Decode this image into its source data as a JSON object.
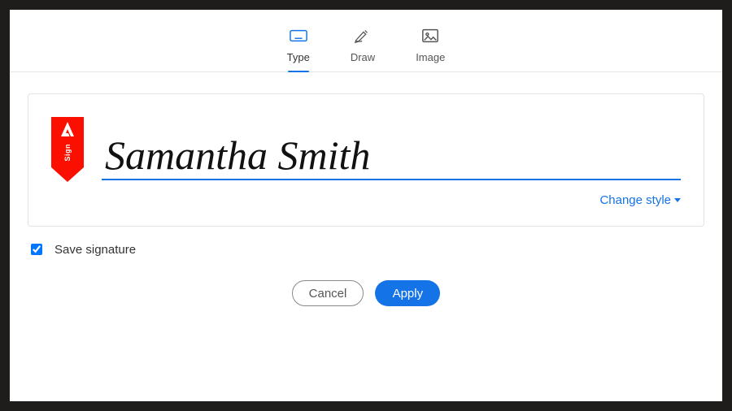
{
  "tabs": {
    "type": "Type",
    "draw": "Draw",
    "image": "Image",
    "active": "type"
  },
  "signature": {
    "tag_label": "Sign",
    "value": "Samantha Smith",
    "change_style": "Change style"
  },
  "save": {
    "label": "Save signature",
    "checked": true
  },
  "buttons": {
    "cancel": "Cancel",
    "apply": "Apply"
  },
  "colors": {
    "accent": "#1473e6",
    "tag": "#fa0f00"
  }
}
